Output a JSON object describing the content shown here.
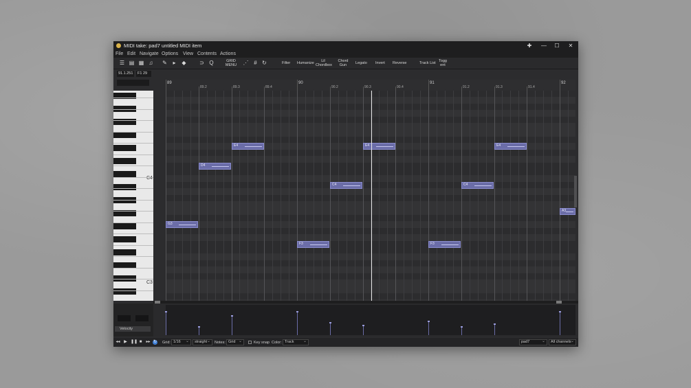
{
  "window": {
    "title": "MIDI take: pad7 untitled MIDI item",
    "controls": [
      "✚",
      "—",
      "☐",
      "✕"
    ]
  },
  "menu": [
    "File",
    "Edit",
    "Navigate",
    "Options",
    "View",
    "Contents",
    "Actions"
  ],
  "toolbar": {
    "icons": [
      "list-icon",
      "grid-view-icon",
      "columns-icon",
      "note-icon",
      "pencil-icon",
      "play-small-icon",
      "diamond-icon",
      "magnet-icon",
      "q-icon"
    ],
    "grid_menu": "GRID\nMENU",
    "buttons": [
      "Filter",
      "Humanize",
      "Lil Chordbox",
      "Chord Gun",
      "Legato",
      "Invert",
      "Reverse",
      "Track List",
      "Togg ent"
    ]
  },
  "position": {
    "time": "91.1.251",
    "field2": "F1  29"
  },
  "ruler": {
    "major": [
      "89",
      "90",
      "91",
      "92"
    ],
    "minor": [
      "89.2",
      "89.3",
      "89.4",
      "90.2",
      "90.3",
      "90.4",
      "91.2",
      "91.3",
      "91.4"
    ]
  },
  "keys": {
    "c4": "C4",
    "c3": "C3"
  },
  "notes": [
    {
      "label": "G3"
    },
    {
      "label": "D4"
    },
    {
      "label": "E4"
    },
    {
      "label": "F3"
    },
    {
      "label": "C4"
    },
    {
      "label": "E4"
    },
    {
      "label": "F3"
    },
    {
      "label": "C4"
    },
    {
      "label": "E4"
    },
    {
      "label": "A3"
    }
  ],
  "lane": {
    "label": "Velocity"
  },
  "bottom": {
    "grid_label": "Grid:",
    "grid_value": "1/16",
    "grid_type": "straight",
    "notes_label": "Notes:",
    "notes_value": "Grid",
    "keysnap_label": "Key snap",
    "color_label": "Color:",
    "color_value": "Track",
    "track_value": "pad7",
    "channel_value": "All channels"
  },
  "colors": {
    "note": "#6b6da8",
    "background": "#2c2c2e",
    "accent": "#3f7fd6"
  }
}
